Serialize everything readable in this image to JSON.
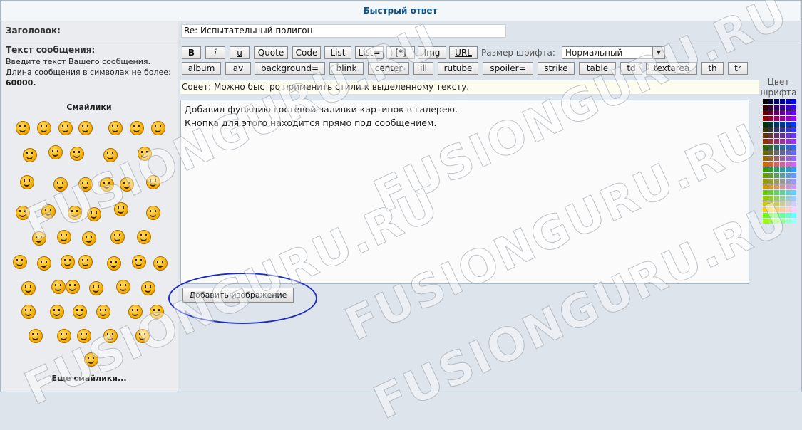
{
  "header": {
    "title": "Быстрый ответ"
  },
  "subject": {
    "label": "Заголовок:",
    "value": "Re: Испытательный полигон"
  },
  "message": {
    "label": "Текст сообщения:",
    "hint_line1": "Введите текст Вашего сообщения.",
    "hint_line2": "Длина сообщения в символах не более:",
    "max_length": "60000",
    "text_line1": "Добавил функцию гостевой заливки картинок в галерею.",
    "text_line2": "Кнопка для этого находится прямо под сообщением."
  },
  "smilies": {
    "title": "Смайлики",
    "more_label": "Еще смайлики..."
  },
  "toolbar": {
    "row1": [
      "B",
      "i",
      "u",
      "Quote",
      "Code",
      "List",
      "List=",
      "[*]",
      "Img",
      "URL"
    ],
    "row2": [
      "album",
      "av",
      "background=",
      "blink",
      "center",
      "ill",
      "rutube",
      "spoiler=",
      "strike",
      "table",
      "td",
      "textarea",
      "th",
      "tr"
    ],
    "fontsize_label": "Размер шрифта:",
    "fontsize_value": "Нормальный"
  },
  "tip": "Совет: Можно быстро применить стили к выделенному тексту.",
  "add_image_button": "Добавить изображение",
  "color_panel": {
    "label_line1": "Цвет",
    "label_line2": "шрифта"
  },
  "watermark": "FUSIONGURU.RU"
}
